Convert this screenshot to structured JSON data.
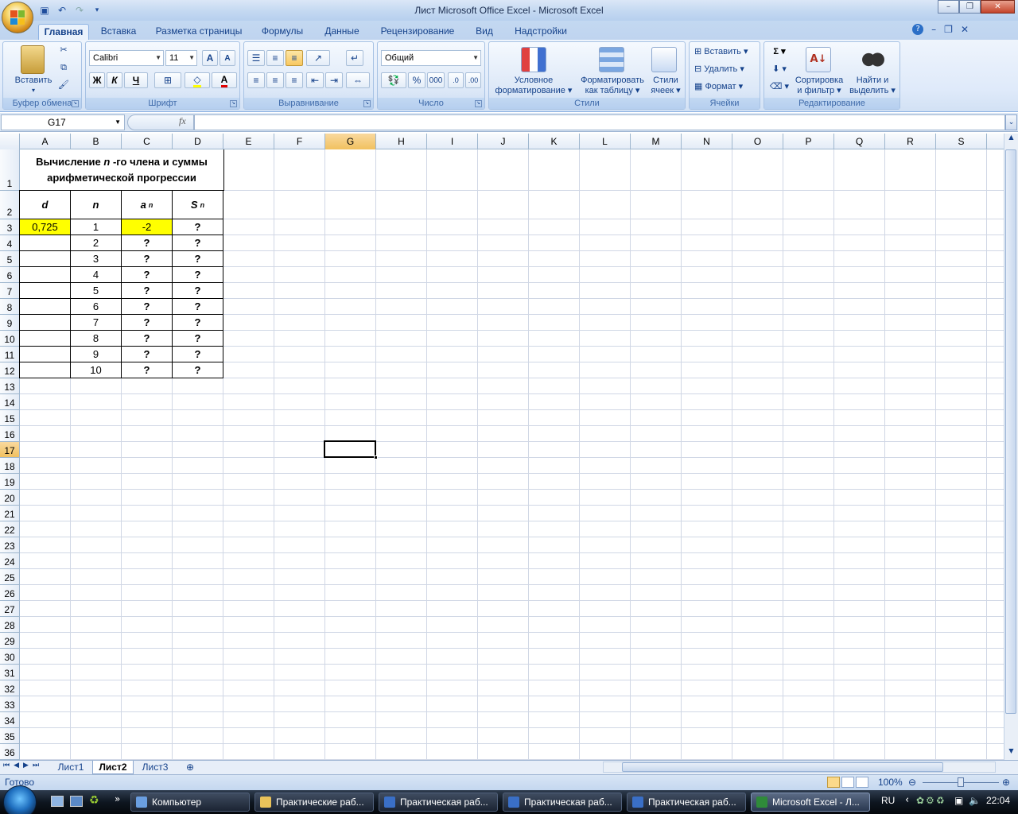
{
  "window": {
    "title": "Лист Microsoft Office Excel - Microsoft Excel",
    "controls": {
      "minimize": "–",
      "restore": "❐",
      "close": "✕"
    }
  },
  "qat": {
    "icons": [
      "save-icon",
      "undo-icon",
      "redo-icon",
      "customize-icon"
    ]
  },
  "ribbon": {
    "tabs": [
      "Главная",
      "Вставка",
      "Разметка страницы",
      "Формулы",
      "Данные",
      "Рецензирование",
      "Вид",
      "Надстройки"
    ],
    "active_tab": "Главная",
    "groups": {
      "clipboard": {
        "label": "Буфер обмена",
        "paste": "Вставить"
      },
      "font": {
        "label": "Шрифт",
        "font_name": "Calibri",
        "font_size": "11",
        "bold": "Ж",
        "italic": "К",
        "underline": "Ч"
      },
      "alignment": {
        "label": "Выравнивание"
      },
      "number": {
        "label": "Число",
        "format": "Общий",
        "percent": "%",
        "thousands": "000"
      },
      "styles": {
        "label": "Стили",
        "cond_format_1": "Условное",
        "cond_format_2": "форматирование",
        "table_format_1": "Форматировать",
        "table_format_2": "как таблицу",
        "cell_styles_1": "Стили",
        "cell_styles_2": "ячеек"
      },
      "cells": {
        "label": "Ячейки",
        "insert": "Вставить",
        "delete": "Удалить",
        "format": "Формат"
      },
      "editing": {
        "label": "Редактирование",
        "sigma": "Σ",
        "sort_1": "Сортировка",
        "sort_2": "и фильтр",
        "find_1": "Найти и",
        "find_2": "выделить"
      }
    }
  },
  "formula_bar": {
    "name_box": "G17",
    "fx": "fx",
    "value": ""
  },
  "sheet": {
    "columns": [
      "A",
      "B",
      "C",
      "D",
      "E",
      "F",
      "G",
      "H",
      "I",
      "J",
      "K",
      "L",
      "M",
      "N",
      "O",
      "P",
      "Q",
      "R",
      "S"
    ],
    "selected_column": "G",
    "selected_row": "17",
    "rows": [
      "1",
      "2",
      "3",
      "4",
      "5",
      "6",
      "7",
      "8",
      "9",
      "10",
      "11",
      "12",
      "13",
      "14",
      "15",
      "16",
      "17",
      "18",
      "19",
      "20",
      "21",
      "22",
      "23",
      "24",
      "25",
      "26",
      "27",
      "28",
      "29",
      "30",
      "31",
      "32",
      "33",
      "34",
      "35",
      "36"
    ],
    "title_line1": "Вычисление n -го члена и суммы",
    "title_line1_pre": "Вычисление ",
    "title_line1_n": "n",
    "title_line1_post": " -го члена и суммы",
    "title_line2": "арифметической прогрессии",
    "headers": {
      "d": "d",
      "n": "n",
      "a": "a",
      "a_sub": "n",
      "s": "S",
      "s_sub": "n"
    },
    "d_value": "0,725",
    "table_rows": [
      {
        "n": "1",
        "a": "-2",
        "s": "?"
      },
      {
        "n": "2",
        "a": "?",
        "s": "?"
      },
      {
        "n": "3",
        "a": "?",
        "s": "?"
      },
      {
        "n": "4",
        "a": "?",
        "s": "?"
      },
      {
        "n": "5",
        "a": "?",
        "s": "?"
      },
      {
        "n": "6",
        "a": "?",
        "s": "?"
      },
      {
        "n": "7",
        "a": "?",
        "s": "?"
      },
      {
        "n": "8",
        "a": "?",
        "s": "?"
      },
      {
        "n": "9",
        "a": "?",
        "s": "?"
      },
      {
        "n": "10",
        "a": "?",
        "s": "?"
      }
    ],
    "highlight_color": "#ffff00"
  },
  "sheet_tabs": [
    "Лист1",
    "Лист2",
    "Лист3"
  ],
  "active_sheet": "Лист2",
  "status": {
    "ready": "Готово",
    "zoom": "100%"
  },
  "taskbar": {
    "buttons": [
      "Компьютер",
      "Практические раб...",
      "Практическая раб...",
      "Практическая раб...",
      "Практическая раб...",
      "Microsoft Excel - Л..."
    ],
    "lang": "RU",
    "time": "22:04"
  }
}
